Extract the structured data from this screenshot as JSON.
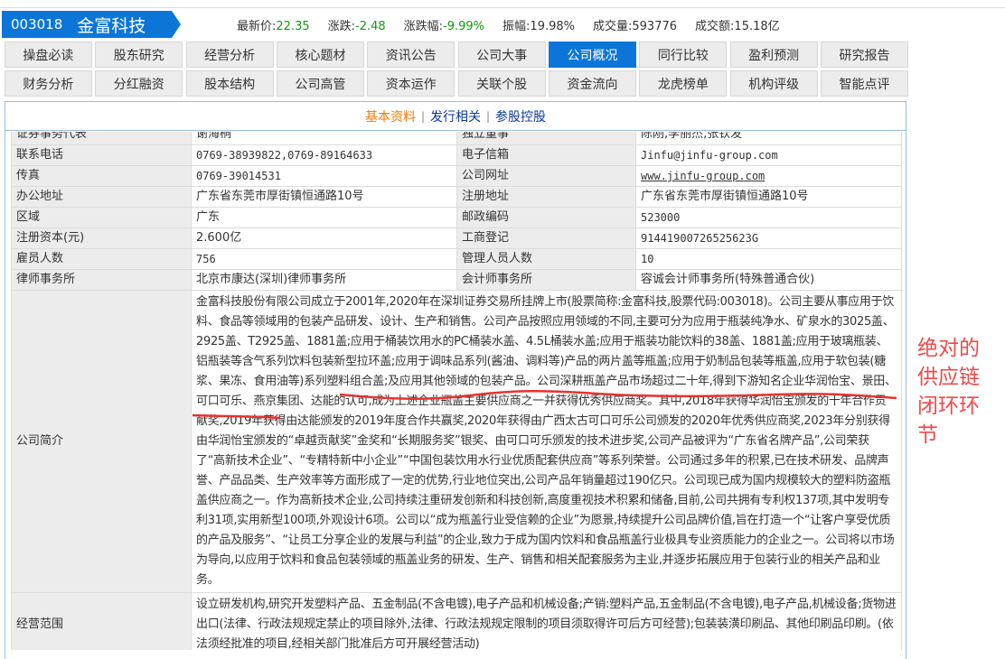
{
  "header": {
    "code": "003018",
    "name": "金富科技",
    "quotes": [
      {
        "label": "最新价:",
        "value": "22.35",
        "color": "green"
      },
      {
        "label": "涨跌:",
        "value": "-2.48",
        "color": "green"
      },
      {
        "label": "涨跌幅:",
        "value": "-9.99%",
        "color": "green"
      },
      {
        "label": "振幅:",
        "value": "19.98%",
        "color": "normal"
      },
      {
        "label": "成交量:",
        "value": "593776",
        "color": "normal"
      },
      {
        "label": "成交额:",
        "value": "15.18亿",
        "color": "normal"
      }
    ]
  },
  "tabs_row1": [
    "操盘必读",
    "股东研究",
    "经营分析",
    "核心题材",
    "资讯公告",
    "公司大事",
    "公司概况",
    "同行比较",
    "盈利预测",
    "研究报告"
  ],
  "tabs_row2": [
    "财务分析",
    "分红融资",
    "股本结构",
    "公司高管",
    "资本运作",
    "关联个股",
    "资金流向",
    "龙虎榜单",
    "机构评级",
    "智能点评"
  ],
  "active_tab": "公司概况",
  "subtabs": {
    "basic": "基本资料",
    "issue": "发行相关",
    "holding": "参股控股",
    "sep": "|"
  },
  "rows": [
    [
      "证券事务代表",
      "谢海桐",
      "独立董事",
      "陈刚,李丽杰,张钦发"
    ],
    [
      "联系电话",
      "0769-38939822,0769-89164633",
      "电子信箱",
      "Jinfu@jinfu-group.com"
    ],
    [
      "传真",
      "0769-39014531",
      "公司网址",
      "www.jinfu-group.com"
    ],
    [
      "办公地址",
      "广东省东莞市厚街镇恒通路10号",
      "注册地址",
      "广东省东莞市厚街镇恒通路10号"
    ],
    [
      "区域",
      "广东",
      "邮政编码",
      "523000"
    ],
    [
      "注册资本(元)",
      "2.600亿",
      "工商登记",
      "91441900726525623G"
    ],
    [
      "雇员人数",
      "756",
      "管理人员人数",
      "10"
    ],
    [
      "律师事务所",
      "北京市康达(深圳)律师事务所",
      "会计师事务所",
      "容诚会计师事务所(特殊普通合伙)"
    ]
  ],
  "intro": {
    "label": "公司简介",
    "text": "金富科技股份有限公司成立于2001年,2020年在深圳证券交易所挂牌上市(股票简称:金富科技,股票代码:003018)。公司主要从事应用于饮料、食品等领域用的包装产品研发、设计、生产和销售。公司产品按照应用领域的不同,主要可分为应用于瓶装纯净水、矿泉水的3025盖、2925盖、T2925盖、1881盖;应用于桶装饮用水的PC桶装水盖、4.5L桶装水盖;应用于瓶装功能饮料的38盖、1881盖;应用于玻璃瓶装、铝瓶装等含气系列饮料包装新型拉环盖;应用于调味品系列(酱油、调料等)产品的两片盖等瓶盖;应用于奶制品包装等瓶盖,应用于软包装(糖浆、果冻、食用油等)系列塑料组合盖;及应用其他领域的包装产品。公司深耕瓶盖产品市场超过二十年,得到下游知名企业华润怡宝、景田、可口可乐、燕京集团、达能的认可,成为上述企业瓶盖主要供应商之一并获得优秀供应商奖。其中,2018年获得华润怡宝颁发的十年合作贡献奖,2019年获得由达能颁发的2019年度合作共赢奖,2020年获得由广西太古可口可乐公司颁发的2020年优秀供应商奖,2023年分别获得由华润怡宝颁发的“卓越贡献奖”金奖和“长期服务奖”银奖、由可口可乐颁发的技术进步奖,公司产品被评为“广东省名牌产品”,公司荣获了“高新技术企业”、“专精特新中小企业”“中国包装饮用水行业优质配套供应商”等系列荣誉。公司通过多年的积累,已在技术研发、品牌声誉、产品品类、生产效率等方面形成了一定的优势,行业地位突出,公司产品年销量超过190亿只。公司现已成为国内规模较大的塑料防盗瓶盖供应商之一。作为高新技术企业,公司持续注重研发创新和科技创新,高度重视技术积累和储备,目前,公司共拥有专利权137项,其中发明专利31项,实用新型100项,外观设计6项。公司以“成为瓶盖行业受信赖的企业”为愿景,持续提升公司品牌价值,旨在打造一个“让客户享受优质的产品及服务”、“让员工分享企业的发展与利益”的企业,致力于成为国内饮料和食品瓶盖行业极具专业资质能力的企业之一。公司将以市场为导向,以应用于饮料和食品包装领域的瓶盖业务的研发、生产、销售和相关配套服务为主业,并逐步拓展应用于包装行业的相关产品和业务。"
  },
  "scope": {
    "label": "经营范围",
    "text": "设立研发机构,研究开发塑料产品、五金制品(不含电镀),电子产品和机械设备;产销:塑料产品,五金制品(不含电镀),电子产品,机械设备;货物进出口(法律、行政法规规定禁止的项目除外,法律、行政法规规定限制的项目须取得许可后方可经营);包装装潢印刷品、其他印刷品印刷。(依法须经批准的项目,经相关部门批准后方可开展经营活动)"
  },
  "annotation": "绝对的供应链闭环环节",
  "colors": {
    "accent": "#0b76d8",
    "down": "#119911",
    "active_subtab": "#f27b00",
    "annotation": "#f04848"
  }
}
